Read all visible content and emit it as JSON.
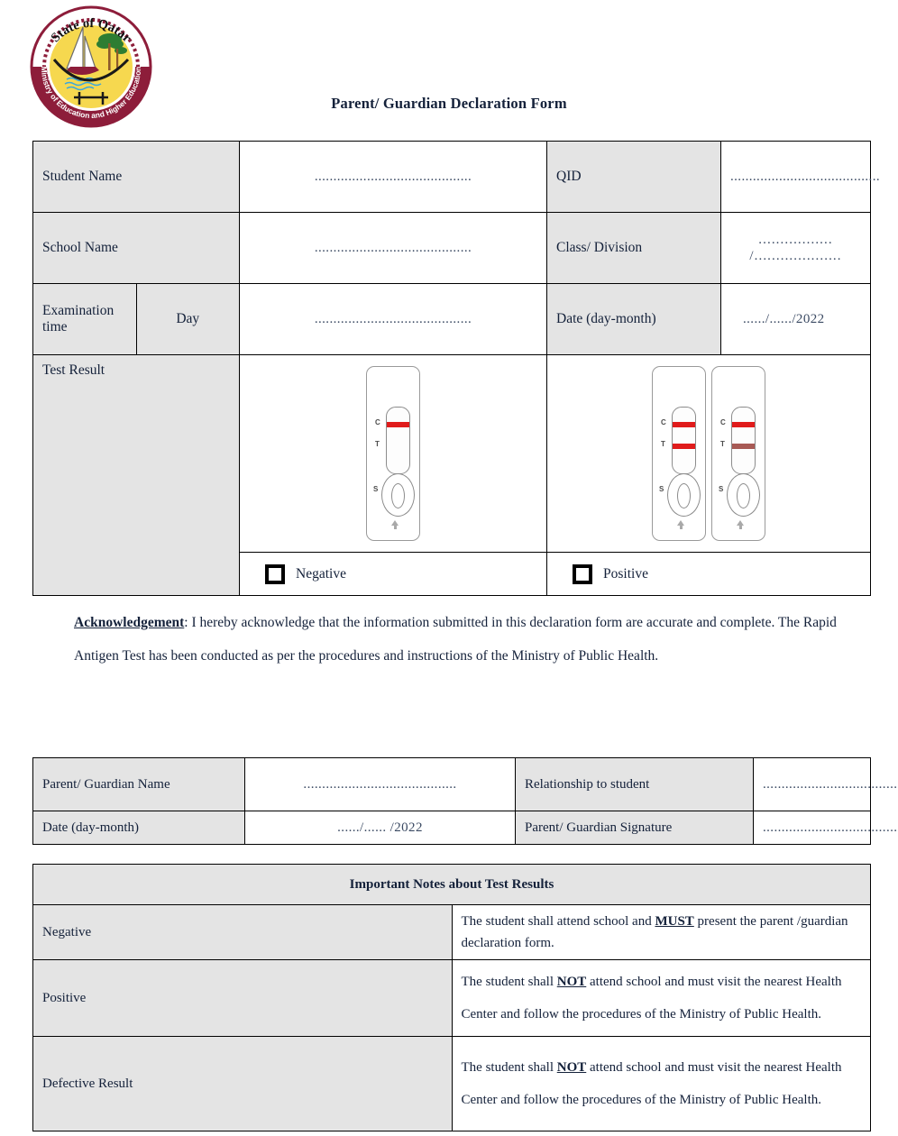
{
  "header": {
    "title": "Parent/ Guardian Declaration Form",
    "logo": {
      "top_text": "State of Qatar",
      "bottom_text": "Ministry of Education and Higher Education",
      "colors": {
        "ring": "#8d1d3a",
        "center": "#f6d84f",
        "water": "#3aa7dd"
      }
    }
  },
  "table1": {
    "rows": [
      {
        "label": "Student Name",
        "value": "..........................................",
        "label2": "QID",
        "value2": "........................................"
      },
      {
        "label": "School Name",
        "value": "..........................................",
        "label2": "Class/ Division",
        "value2": "................. /...................."
      },
      {
        "label": "Examination time",
        "sublabel": "Day",
        "value": "..........................................",
        "label2": "Date (day-month)",
        "value2": "....../....../2022"
      }
    ],
    "test_result_label": "Test Result",
    "negative": {
      "checkbox_label": "Negative",
      "cassettes": [
        {
          "c_line": true,
          "t_line": false,
          "t_faint": false
        }
      ]
    },
    "positive": {
      "checkbox_label": "Positive",
      "cassettes": [
        {
          "c_line": true,
          "t_line": true,
          "t_faint": false
        },
        {
          "c_line": true,
          "t_line": true,
          "t_faint": true
        }
      ]
    },
    "cassette_markers": {
      "c": "C",
      "t": "T",
      "s": "S"
    }
  },
  "acknowledgement": {
    "heading": "Acknowledgement",
    "text_after_heading": ": I hereby acknowledge that the information submitted in this declaration form are accurate and complete. The Rapid Antigen Test has been conducted as per the procedures and instructions of the Ministry of Public Health."
  },
  "table2": {
    "rows": [
      {
        "label": "Parent/ Guardian Name",
        "value": ".........................................",
        "label2": "Relationship to student",
        "value2": "......................................."
      },
      {
        "label": "Date (day-month)",
        "value": "....../...... /2022",
        "label2": "Parent/ Guardian Signature",
        "value2": "......................................."
      }
    ]
  },
  "notes": {
    "header": "Important Notes about Test Results",
    "rows": [
      {
        "label": "Negative",
        "text_before": "The student shall attend school and ",
        "emphasis": "MUST",
        "text_after": " present the parent /guardian declaration form."
      },
      {
        "label": "Positive",
        "text_before": "The student shall ",
        "emphasis": "NOT",
        "text_after": " attend school and must visit the nearest Health Center and follow the procedures of the Ministry of Public Health."
      },
      {
        "label": "Defective Result",
        "text_before": "The student shall ",
        "emphasis": "NOT",
        "text_after": " attend school and must visit the nearest Health Center and follow the procedures of the Ministry of Public Health."
      }
    ]
  }
}
